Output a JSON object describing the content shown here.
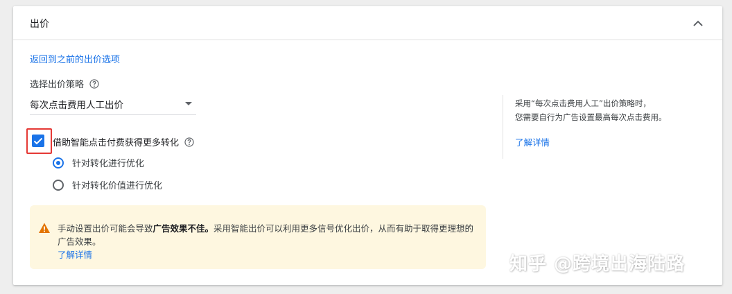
{
  "section": {
    "title": "出价",
    "collapse_icon": "chevron-up-icon"
  },
  "back_link": "返回到之前的出价选项",
  "strategy": {
    "label": "选择出价策略",
    "help_icon": "help-circle-icon",
    "selected_value": "每次点击费用人工出价"
  },
  "enhanced_cpc": {
    "checked": true,
    "label": "借助智能点击付费获得更多转化",
    "help_icon": "help-circle-icon",
    "options": [
      {
        "label": "针对转化进行优化",
        "selected": true
      },
      {
        "label": "针对转化价值进行优化",
        "selected": false
      }
    ]
  },
  "warning": {
    "icon": "warning-triangle-icon",
    "text_before": "手动设置出价可能会导致",
    "text_bold": "广告效果不佳。",
    "text_after": "采用智能出价可以利用更多信号优化出价，从而有助于取得更理想的广告效果。",
    "link": "了解详情"
  },
  "side_info": {
    "line1": "采用“每次点击费用人工”出价策略时，",
    "line2": "您需要自行为广告设置最高每次点击费用。",
    "link": "了解详情"
  },
  "watermark": "知乎 @跨境出海陆路",
  "colors": {
    "accent": "#1a73e8",
    "warning_bg": "#fef7e0",
    "warning_icon": "#e37400",
    "highlight": "#e53935"
  }
}
